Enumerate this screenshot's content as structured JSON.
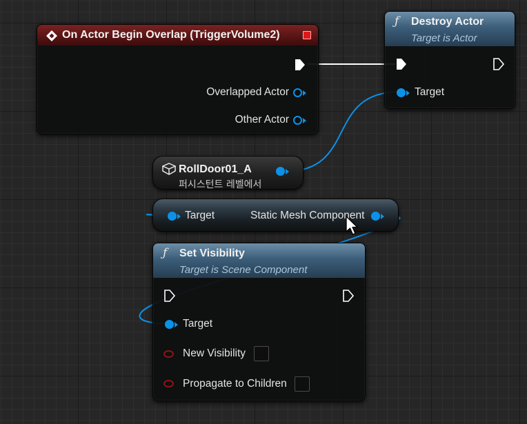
{
  "event_node": {
    "title": "On Actor Begin Overlap (TriggerVolume2)",
    "pins": {
      "overlapped_actor": "Overlapped Actor",
      "other_actor": "Other Actor"
    }
  },
  "destroy_node": {
    "title": "Destroy Actor",
    "subtitle": "Target is Actor",
    "pins": {
      "target": "Target"
    }
  },
  "ref_node": {
    "title": "RollDoor01_A",
    "subtitle": "퍼시스턴트 레벨에서"
  },
  "getter_node": {
    "pins": {
      "target": "Target",
      "output": "Static Mesh Component"
    }
  },
  "visibility_node": {
    "title": "Set Visibility",
    "subtitle": "Target is Scene Component",
    "pins": {
      "target": "Target",
      "new_visibility": "New Visibility",
      "propagate": "Propagate to Children"
    },
    "new_visibility_checked": false,
    "propagate_checked": false
  },
  "colors": {
    "event_header": "#7a2222",
    "function_header": "#3c5e7a",
    "object_pin": "#0b92e8",
    "bool_pin": "#8d1515",
    "exec_pin": "#ffffff",
    "canvas": "#262626"
  },
  "icons": {
    "event": "event-diamond-icon",
    "function": "function-f-icon",
    "actor_reference": "actor-cube-icon",
    "delegate": "red-square-icon",
    "cursor": "mouse-pointer-icon"
  }
}
